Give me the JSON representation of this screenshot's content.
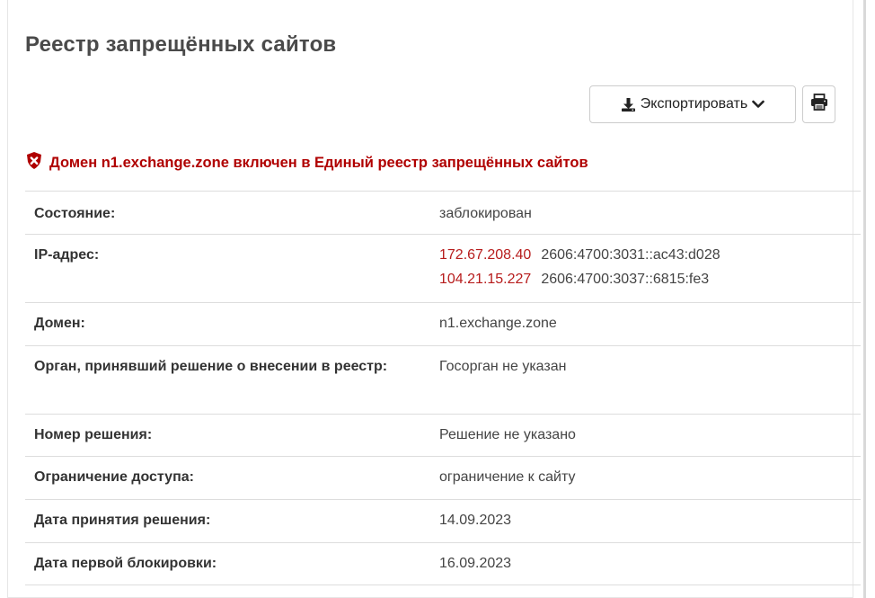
{
  "page": {
    "title": "Реестр запрещённых сайтов"
  },
  "toolbar": {
    "export_label": "Экспортировать",
    "export_icon": "download-icon",
    "dropdown_icon": "chevron-down-icon",
    "print_icon": "print-icon"
  },
  "alert": {
    "icon": "shield-icon",
    "text": "Домен n1.exchange.zone включен в Единый реестр запрещённых сайтов",
    "color": "#b00000"
  },
  "details": {
    "status": {
      "label": "Состояние:",
      "value": "заблокирован"
    },
    "ip": {
      "label": "IP-адрес:",
      "entries": [
        {
          "v4": "172.67.208.40",
          "v6": "2606:4700:3031::ac43:d028"
        },
        {
          "v4": "104.21.15.227",
          "v6": "2606:4700:3037::6815:fe3"
        }
      ]
    },
    "domain": {
      "label": "Домен:",
      "value": "n1.exchange.zone"
    },
    "authority": {
      "label": "Орган, принявший решение о внесении в реестр:",
      "value": "Госорган не указан"
    },
    "decision_number": {
      "label": "Номер решения:",
      "value": "Решение не указано"
    },
    "restriction": {
      "label": "Ограничение доступа:",
      "value": "ограничение к сайту"
    },
    "decision_date": {
      "label": "Дата принятия решения:",
      "value": "14.09.2023"
    },
    "first_block_date": {
      "label": "Дата первой блокировки:",
      "value": "16.09.2023"
    }
  },
  "colors": {
    "accent_red": "#b71c1c",
    "border": "#dddddd"
  }
}
